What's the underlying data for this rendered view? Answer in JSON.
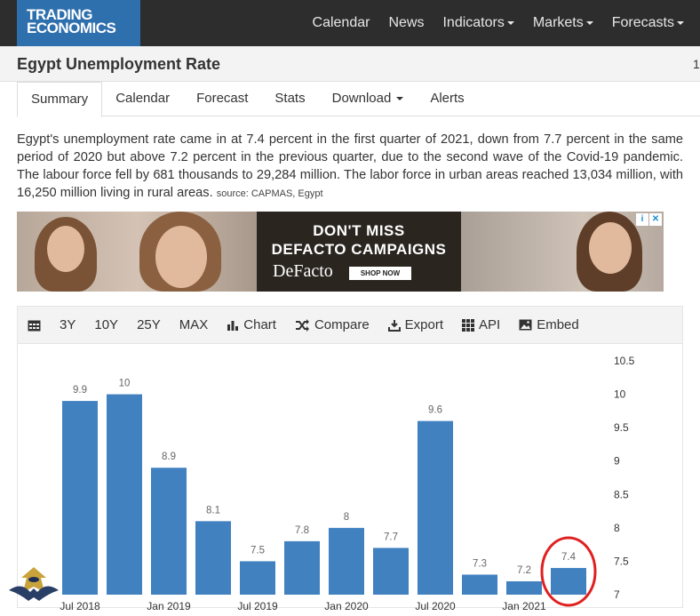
{
  "brand": {
    "line1": "TRADING",
    "line2": "ECONOMICS"
  },
  "nav": [
    {
      "label": "Calendar",
      "dropdown": false
    },
    {
      "label": "News",
      "dropdown": false
    },
    {
      "label": "Indicators",
      "dropdown": true
    },
    {
      "label": "Markets",
      "dropdown": true
    },
    {
      "label": "Forecasts",
      "dropdown": true
    }
  ],
  "page": {
    "title": "Egypt Unemployment Rate",
    "edge_text": "1"
  },
  "tabs": [
    {
      "label": "Summary",
      "active": true
    },
    {
      "label": "Calendar"
    },
    {
      "label": "Forecast"
    },
    {
      "label": "Stats"
    },
    {
      "label": "Download",
      "dropdown": true
    },
    {
      "label": "Alerts"
    }
  ],
  "description": {
    "text": "Egypt's unemployment rate came in at 7.4 percent in the first quarter of 2021, down from 7.7 percent in the same period of 2020 but above 7.2 percent in the previous quarter, due to the second wave of the Covid-19 pandemic. The labour force fell by 681 thousands to 29,284 million. The labor force in urban areas reached 13,034 million, with 16,250 million living in rural areas.",
    "source": "source: CAPMAS, Egypt"
  },
  "ad": {
    "headline1": "DON'T MISS",
    "headline2": "DEFACTO CAMPAIGNS",
    "brand": "DeFacto",
    "cta": "SHOP NOW",
    "info_icon": "i",
    "close_icon": "✕"
  },
  "toolbar": {
    "calendar_icon": "calendar-icon",
    "ranges": [
      "3Y",
      "10Y",
      "25Y",
      "MAX"
    ],
    "chart": "Chart",
    "compare": "Compare",
    "export": "Export",
    "api": "API",
    "embed": "Embed"
  },
  "chart_data": {
    "type": "bar",
    "categories": [
      "Q2 2018",
      "Q3 2018",
      "Q4 2018",
      "Q1 2019",
      "Q2 2019",
      "Q3 2019",
      "Q4 2019",
      "Q1 2020",
      "Q2 2020",
      "Q3 2020",
      "Q4 2020",
      "Q1 2021"
    ],
    "values": [
      9.9,
      10,
      8.9,
      8.1,
      7.5,
      7.8,
      8,
      7.7,
      9.6,
      7.3,
      7.2,
      7.4
    ],
    "data_labels": [
      "9.9",
      "10",
      "8.9",
      "8.1",
      "7.5",
      "7.8",
      "8",
      "7.7",
      "9.6",
      "7.3",
      "7.2",
      "7.4"
    ],
    "x_tick_labels": [
      "Jul 2018",
      "Jan 2019",
      "Jul 2019",
      "Jan 2020",
      "Jul 2020",
      "Jan 2021"
    ],
    "y_tick_labels": [
      "10.5",
      "10",
      "9.5",
      "9",
      "8.5",
      "8",
      "7.5",
      "7"
    ],
    "ylim": [
      7,
      10.5
    ],
    "y_axis_side": "right",
    "bar_color": "#4181c0",
    "highlight": {
      "index": 11,
      "color": "#e02020",
      "shape": "circle"
    },
    "grid": false
  }
}
